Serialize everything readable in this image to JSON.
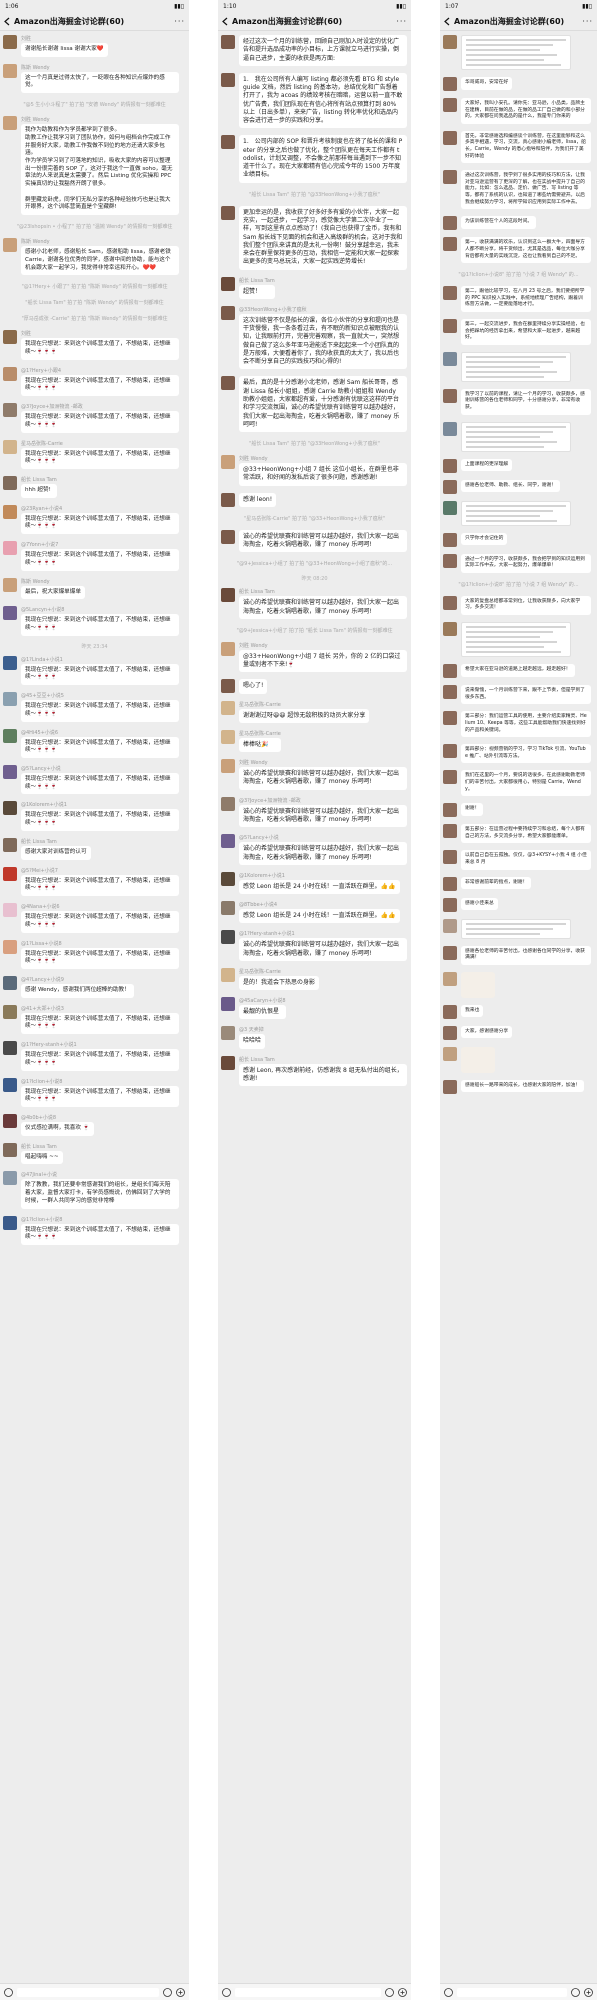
{
  "panel1": {
    "status_time": "1:06",
    "title": "Amazon出海掘金讨论群(60)",
    "messages": [
      {
        "kind": "msg",
        "sender": "刘胜",
        "text": "谢谢船长谢谢 lissa 谢谢大家❤️",
        "color": "#8a6a4a"
      },
      {
        "kind": "msg",
        "sender": "陈斯 Wendy",
        "text": "这一个月真是过得太快了，一眨眼在各种知识点爆炸的感觉。",
        "color": "#c9a07a"
      },
      {
        "kind": "sys",
        "text": "\"@5 生小小斗程了\" 拍了拍 \"安德 Wendy\" 的情报有一刻都难住"
      },
      {
        "kind": "msg",
        "sender": "刘胜 Wendy",
        "text": "我作为助教和作为学员都学到了很多。\n助教工作让我学习到了团队协作，如何与组档合作完成工作并服务好大家，助教工作我做不到位的地方还请大家多包涵。\n作为学员学习到了可落地的知识，吸收大家的内容可以整理出一份很完善的 SOP 了，这对于我这个一直做 soho，毫无章法的人来说真是太需要了。然后 Listing 优化实操和 PPC 实操真切的让我豁然开朗了很多。\n\n群里藏龙卧虎，同学们无私分享的各种经验技巧也是让我大开眼界，这个训练营简直是个宝藏群!",
        "color": "#c9a07a"
      },
      {
        "kind": "sys",
        "text": "\"@23Ishopsin • 小程了\" 拍了拍 \"温婉 Wendy\" 的情报有一刻都难住"
      },
      {
        "kind": "msg",
        "sender": "陈斯 Wendy",
        "text": "感谢小北老师，感谢船长 Sam，感谢船助 lissa，感谢老铁 Carrie，谢谢各位优秀的同学，感谢中间的协助，能与这个机会跟大家一起学习，我觉得非常幸运和开心。❤️❤️",
        "color": "#c9a07a"
      },
      {
        "kind": "sys",
        "text": "\"@1?Hery+ 小跟了\" 拍了拍 \"陈斯 Wendy\" 的情报有一刻都难住"
      },
      {
        "kind": "sys",
        "text": "\"船长 Lissa Tam\" 拍了拍 \"陈斯 Wendy\" 的情报有一刻都难住"
      },
      {
        "kind": "sys",
        "text": "\"厚马岳成张 -Carrie\" 拍了拍 \"陈斯 Wendy\" 的情报有一刻都难住"
      },
      {
        "kind": "msg",
        "sender": "刘胜",
        "text": "我现在只想说：来到这个训练营太值了，不想结束，还想继续～🍷🍷🍷",
        "color": "#8a6a4a"
      },
      {
        "kind": "msg",
        "sender": "@1?Hery+小跟4",
        "text": "我现在只想说：来到这个训练营太值了，不想结束，还想继续～🍷🍷🍷",
        "color": "#b98d6a"
      },
      {
        "kind": "msg",
        "sender": "@3?Joyce+加洲物流 -邮政",
        "text": "我现在只想说：来到这个训练营太值了，不想结束，还想继续～🍷🍷🍷",
        "color": "#8f7b6a"
      },
      {
        "kind": "msg",
        "sender": "星马岳张陈-Carrie",
        "text": "我现在只想说：来到这个训练营太值了，不想结束，还想继续～🍷🍷🍷",
        "color": "#d2b48c"
      },
      {
        "kind": "msg",
        "sender": "船长 Lissa Tam",
        "text": "hhh 超赞!",
        "color": "#7f6a5a"
      },
      {
        "kind": "msg",
        "sender": "@23Ryan+小说4",
        "text": "我现在只想说：来到这个训练营太值了，不想结束，还想继续～🍷🍷🍷",
        "color": "#c18a5a"
      },
      {
        "kind": "msg",
        "sender": "@7Yonn+小说7",
        "text": "我现在只想说：来到这个训练营太值了，不想结束，还想继续～🍷🍷🍷",
        "color": "#e8a0b0"
      },
      {
        "kind": "msg",
        "sender": "陈斯 Wendy",
        "text": "最后，祝大家爆单爆单",
        "color": "#c9a07a"
      },
      {
        "kind": "msg",
        "sender": "@5Lancyn+小说8",
        "text": "我现在只想说：来到这个训练营太值了，不想结束，还想继续～🍷🍷🍷",
        "color": "#6f5f8f"
      },
      {
        "kind": "time",
        "text": "昨天 23:34"
      },
      {
        "kind": "msg",
        "sender": "@1?Linda+小说1",
        "text": "我现在只想说：来到这个训练营太值了，不想结束，还想继续～🍷🍷🍷",
        "color": "#3c5f8f"
      },
      {
        "kind": "msg",
        "sender": "@45+豆豆+小说5",
        "text": "我现在只想说：来到这个训练营太值了，不想结束，还想继续～🍷🍷🍷",
        "color": "#8aa0b0"
      },
      {
        "kind": "msg",
        "sender": "@4Hi45+小说6",
        "text": "我现在只想说：来到这个训练营太值了，不想结束，还想继续～🍷🍷🍷",
        "color": "#5f7f5f"
      },
      {
        "kind": "msg",
        "sender": "@5?Lancy+小说",
        "text": "我现在只想说：来到这个训练营太值了，不想结束，还想继续～🍷🍷🍷",
        "color": "#6f5f8f"
      },
      {
        "kind": "msg",
        "sender": "@1Kolorem+小说1",
        "text": "我现在只想说：来到这个训练营太值了，不想结束，还想继续～🍷🍷🍷",
        "color": "#5a4a3a"
      },
      {
        "kind": "msg",
        "sender": "船长 Lissa Tam",
        "text": "感谢大家对训练营的认可",
        "color": "#7f6a5a"
      },
      {
        "kind": "msg",
        "sender": "@5?Mei+小说7",
        "text": "我现在只想说：来到这个训练营太值了，不想结束，还想继续～🍷🍷🍷",
        "color": "#c0392b"
      },
      {
        "kind": "msg",
        "sender": "@4Nana+小说6",
        "text": "我现在只想说：来到这个训练营太值了，不想结束，还想继续～🍷🍷🍷",
        "color": "#e8c0d0"
      },
      {
        "kind": "msg",
        "sender": "@1?Lissa+小说8",
        "text": "我现在只想说：来到这个训练营太值了，不想结束，还想继续～🍷🍷🍷",
        "color": "#d9a080"
      },
      {
        "kind": "msg",
        "sender": "@4?Lancy+小说9",
        "text": "感谢 Wendy，感谢我们两位超棒的助教！",
        "color": "#5a6a7a"
      },
      {
        "kind": "msg",
        "sender": "@41+大郑+小说3",
        "text": "我现在只想说：来到这个训练营太值了，不想结束，还想继续～🍷🍷🍷",
        "color": "#8a7a5a"
      },
      {
        "kind": "msg",
        "sender": "@1?Hery-stanh+小说1",
        "text": "我现在只想说：来到这个训练营太值了，不想结束，还想继续～🍷🍷🍷",
        "color": "#4a4a4a"
      },
      {
        "kind": "msg",
        "sender": "@1?Iclion+小说8",
        "text": "我现在只想说：来到这个训练营太值了，不想结束，还想继续～🍷🍷🍷",
        "color": "#3a5a8a"
      },
      {
        "kind": "msg",
        "sender": "@4b0b+小说8",
        "text": "仪式感拉满啊，我喜欢 🍷",
        "color": "#6a3a3a"
      },
      {
        "kind": "msg",
        "sender": "船长 Lissa Tam",
        "text": "唱起嗨嗨 ~~",
        "color": "#7f6a5a"
      },
      {
        "kind": "msg",
        "sender": "@47Jinal+小说",
        "text": "除了教教，我们还要非常感谢我们的组长，是组长们每天陪着大家，监督大家打卡，有学员感慨说，仿佛回到了大学的时候，一群人共同学习的感觉非常棒",
        "color": "#8a9aaa"
      },
      {
        "kind": "msg",
        "sender": "@1?Iclion+小说8",
        "text": "我现在只想说：来到这个训练营太值了，不想结束，还想继续～🍷🍷🍷",
        "color": "#3a5a8a"
      }
    ]
  },
  "panel2": {
    "status_time": "1:10",
    "title": "Amazon出海掘金讨论群(60)",
    "messages": [
      {
        "kind": "msg",
        "sender": "",
        "text": "经过这次一个月的训练营，回顾自己刚加入时设定的优化广告和提升选品成功率的小目标，上方课就立马进行实操，倒逼自己进步，主要的收获是两方面:",
        "color": "#7a5a4a"
      },
      {
        "kind": "msg",
        "sender": "",
        "text": "1.　我在公司所有人编写 listing 都必须先看 BTG 和 style guide 文档，然后 listing 的基本功，总结优化和广告想着打开了，我为 acoas 的绩效考核在暗暗，运营以前一直不敢优广告费，我们团队现在有信心将所有站点预算打到 80% 以上（日出多单），来来广告，listing 转化率优化和选品内容会进行进一步的实践和分享。",
        "color": "#7a5a4a"
      },
      {
        "kind": "msg",
        "sender": "",
        "text": "1.　公司内部的 SOP 和晋升考核制度也在将了船长的课和 Peter 的分享之后也做了优化，整个团队更在每天工作都有 todolist，计划又调整，不会像之前那样每当遇到下一步不知道干什么了。现在大家都精有信心完成今年的 1500 万年度业绩目标。",
        "color": "#7a5a4a"
      },
      {
        "kind": "sys",
        "text": "\"船长 Lissa Tam\" 拍了拍 \"@33HeonWong+小我了瘟秋\""
      },
      {
        "kind": "msg",
        "sender": "",
        "text": "更加幸运的是，我收获了好多好多有爱的小伙伴，大家一起充实，一起进步，一起学习，感觉像大学第二次毕业了一样，写到这里有点点感动了！(我自己也获得了金币，我有和 Sam 船长线下见面的机会和进入高级群的机会，这对于我和我们整个团队来讲真的是太礼一份啊！鼓分享越幸运，我未来会在群里保持更多的互动，我相信一定能和大家一起探索出更多的变马总玩法，大家一起实践逆势增长!",
        "color": "#7a5a4a"
      },
      {
        "kind": "msg",
        "sender": "船长 Lissa Tam",
        "text": "超赞！",
        "color": "#6a4a3a"
      },
      {
        "kind": "msg",
        "sender": "@33HeonWong+小我了瘟秋",
        "text": "这次训练营不仅是船长的课，各位小伙伴的分享和提问也是干货慢慢，我一条条看过去，有不眠的新知识点被眠我的认知，让我眼前打开，完善完善观察，我一直就大一，突然想做自己做了这么多年亚马逊能适下来起起来一个小团队真的是万般难，大便看着你了，我的收获真的太大了，我以后也会不断分享自己的实践技巧和心得的!",
        "color": "#7a5a4a"
      },
      {
        "kind": "msg",
        "sender": "",
        "text": "最后，真的是十分感谢小北老师，感谢 Sam 船长哥哥，感谢 Lissa 船长小姐姐，感谢 Carrie 助教小姐姐和 Wendy 助教小姐姐，大家都超有爱，十分感谢有优联这这样的平台和学习交流氛围，诚心的希望优联有训练营可以越办越好，我们大家一起出海掏金，吃着火锅唱着歌，赚了 money 乐呵呵!",
        "color": "#7a5a4a"
      },
      {
        "kind": "sys",
        "text": "\"船长 Lissa Tam\" 拍了拍 \"@33HeonWong+小我了瘟秋\""
      },
      {
        "kind": "msg",
        "sender": "刘胜 Wendy",
        "text": "@33+HeonWong+小组 7 组长 这位小组长，在群里也非常活跃，和好闻的发私后谈了很多问题，感谢感谢!",
        "color": "#c9a07a"
      },
      {
        "kind": "msg",
        "sender": "",
        "text": "感谢 leon!",
        "color": "#7a5a4a"
      },
      {
        "kind": "sys",
        "text": "\"星马岳张陈-Carrie\" 拍了拍 \"@33+HeonWong+小我了瘟秋\""
      },
      {
        "kind": "msg",
        "sender": "",
        "text": "诚心的希望优联赛和训练营可以越办越好，我们大家一起出海掏金，吃着火锅唱着歌，赚了 money 乐呵呵!",
        "color": "#7a5a4a"
      },
      {
        "kind": "sys",
        "text": "\"@9+Jessica+小组了 拍了拍 \"@33+HeonWong+小组了瘟秋\"的..."
      },
      {
        "kind": "time",
        "text": "昨天 08:20"
      },
      {
        "kind": "msg",
        "sender": "船长 Lissa Tam",
        "text": "诚心的希望优联赛和训练营可以越办越好，我们大家一起出海掏金，吃着火锅唱着歌，赚了 money 乐呵呵!",
        "color": "#6a4a3a"
      },
      {
        "kind": "sys",
        "text": "\"@9+Jessica+小组了 拍了拍 \"船长 Lissa Tam\" 的情报有一刻都难住"
      },
      {
        "kind": "msg",
        "sender": "刘胜 Wendy",
        "text": "@33+HeonWong+小组 7 组长 另外，你的 2 亿的口袋过量或别者不下来!🍷",
        "color": "#c9a07a"
      },
      {
        "kind": "msg",
        "sender": "",
        "text": "嗯心了!",
        "color": "#7a5a4a"
      },
      {
        "kind": "msg",
        "sender": "星马岳张陈-Carrie",
        "text": "谢谢谢过呀😆😆 超惊无敌积极的动员大家分享",
        "color": "#d2b48c"
      },
      {
        "kind": "msg",
        "sender": "星马岳张陈-Carrie",
        "text": "棒棒哒🎉",
        "color": "#d2b48c"
      },
      {
        "kind": "msg",
        "sender": "刘胜 Wendy",
        "text": "诚心的希望优联赛和训练营可以越办越好，我们大家一起出海掏金，吃着火锅唱着歌，赚了 money 乐呵呵!",
        "color": "#c9a07a"
      },
      {
        "kind": "msg",
        "sender": "@3?Joyce+加洲物流 -邮政",
        "text": "诚心的希望优联赛和训练营可以越办越好，我们大家一起出海掏金，吃着火锅唱着歌，赚了 money 乐呵呵!",
        "color": "#8f7b6a"
      },
      {
        "kind": "msg",
        "sender": "@5?Lancy+小说",
        "text": "诚心的希望优联赛和训练营可以越办越好，我们大家一起出海掏金，吃着火锅唱着歌，赚了 money 乐呵呵!",
        "color": "#6f5f8f"
      },
      {
        "kind": "msg",
        "sender": "@1Kolorem+小说1",
        "text": "感觉 Leon 组长是 24 小时在线！一直活跃在群里。👍👍",
        "color": "#5a4a3a"
      },
      {
        "kind": "msg",
        "sender": "@8Tbbe+小说4",
        "text": "感觉 Leon 组长是 24 小时在线！一直活跃在群里。👍👍",
        "color": "#8a7a6a"
      },
      {
        "kind": "msg",
        "sender": "@1?Hery-stanh+小说1",
        "text": "诚心的希望优联赛和训练营可以越办越好，我们大家一起出海掏金，吃着火锅唱着歌，赚了 money 乐呵呵!",
        "color": "#4a4a4a"
      },
      {
        "kind": "msg",
        "sender": "星马岳张陈-Carrie",
        "text": "是的！我道会下热思の身影",
        "color": "#d2b48c"
      },
      {
        "kind": "msg",
        "sender": "@45aCaryn+小说8",
        "text": "最靓的仇恨星",
        "color": "#6a5a8a"
      },
      {
        "kind": "msg",
        "sender": "@3 天卖掉",
        "text": "哈哈哈",
        "color": "#9a8a7a"
      },
      {
        "kind": "msg",
        "sender": "船长 Lissa Tam",
        "text": "感谢 Leon, 再次感谢前经，仿感谢我 8 组无私付出的组长，感谢!",
        "color": "#6a4a3a"
      }
    ]
  },
  "panel3": {
    "status_time": "1:07",
    "title": "Amazon出海掘金讨论群(60)",
    "messages": [
      {
        "kind": "img",
        "sender": "",
        "lines": 6,
        "color": "#9a7a5a"
      },
      {
        "kind": "msg",
        "sender": "",
        "text": "华哥威哥，安常在好",
        "color": "#8a6a5a"
      },
      {
        "kind": "msg",
        "sender": "",
        "text": "大家好，我叫小安孔。请你先：亚马逊，小品类，品牌主在建精，目前在做的品，在做的品工厂自己做的和小部分的，大家都在问我选品的是什么，我是专门你来的",
        "color": "#8a6a5a"
      },
      {
        "kind": "msg",
        "sender": "",
        "text": "首先，非常感谢选和编感谈个训练营，在这里能够和这么多高手相遇，学习，交流，真心感谢小编老师，lissa，船长，Carrie，Wendy 的悉心指导和陪伴，为我们开了美好的体验",
        "color": "#8a6a5a"
      },
      {
        "kind": "msg",
        "sender": "",
        "text": "通过这次训练营，我学到了很多实用的技巧和方法，让我对亚马逊运营有了更深的了解，也在实战中提升了自己的能力。比如：怎么选品、定价、做广告、写 listing 等等，都有了系统的认识，也知道了哪些坑需要避开。以后我会继续努力学习，将所学知识应用到实际工作中去。",
        "color": "#8a6a5a"
      },
      {
        "kind": "msg",
        "sender": "",
        "text": "为该训练营在个人的这段时间。",
        "color": "#8a6a5a"
      },
      {
        "kind": "msg",
        "sender": "",
        "text": "第一，收获满满的欢乐，认识到这么一群大牛，四面导方人都不断分享，将干货倾出，尤其是选品，每位大咖分享背后都有大量的实践沉淀，这也让我看到自己的不足。",
        "color": "#8a6a5a"
      },
      {
        "kind": "sys",
        "text": "\"@1?Iclion+小说8\" 拍了拍 \"小说 7 组 Wendy\" 的..."
      },
      {
        "kind": "msg",
        "sender": "",
        "text": "第二，跟他比较学习，在八月 23 号之后，我们要把所学的 PPC 知识投入实践中，系统地梳理广告结构，跟着训练营方法做，一定要能落地才行。",
        "color": "#8a6a5a"
      },
      {
        "kind": "msg",
        "sender": "",
        "text": "第三，一起交流进步，我会在群里持续分享实操经验，也会把踩坑的经历拿出来，希望和大家一起进步，越来越好。",
        "color": "#8a6a5a"
      },
      {
        "kind": "img",
        "sender": "",
        "lines": 5,
        "color": "#7a8a9a"
      },
      {
        "kind": "msg",
        "sender": "",
        "text": "我学习了以前的课程，请让一个月的学习，收获颇多，感谢训练营的各位老师和同学，十分感谢分享，非常有收获。",
        "color": "#8a6a5a"
      },
      {
        "kind": "img",
        "sender": "",
        "lines": 5,
        "color": "#7a8a9a"
      },
      {
        "kind": "msg",
        "sender": "",
        "text": "上面课程的更深理解",
        "color": "#8a6a5a"
      },
      {
        "kind": "msg",
        "sender": "",
        "text": "感谢各位老师、助教、组长、同学，谢谢！",
        "color": "#8a6a5a"
      },
      {
        "kind": "img",
        "sender": "",
        "lines": 4,
        "color": "#5a7a6a"
      },
      {
        "kind": "msg",
        "sender": "",
        "text": "只学你才会记住的",
        "color": "#8a6a5a"
      },
      {
        "kind": "msg",
        "sender": "",
        "text": "通过一个月的学习，收获颇多，我会把学到的知识运用到实际工作中去，大家一起努力，爆单爆单！",
        "color": "#8a6a5a"
      },
      {
        "kind": "sys",
        "text": "\"@1?Iclion+小说8\" 拍了拍 \"小说 7 组 Wendy\" 的..."
      },
      {
        "kind": "msg",
        "sender": "",
        "text": "大家的复盘总结都非常到位，让我收获颇多，向大家学习，多多交流！",
        "color": "#8a6a5a"
      },
      {
        "kind": "img",
        "sender": "",
        "lines": 6,
        "color": "#9a7a5a"
      },
      {
        "kind": "msg",
        "sender": "",
        "text": "希望大家在亚马逊的道路上越走越远，越走越好！",
        "color": "#8a6a5a"
      },
      {
        "kind": "msg",
        "sender": "",
        "text": "说来惭愧，一个月训练营下来，跟不上节奏，但是学到了很多东西。",
        "color": "#8a6a5a"
      },
      {
        "kind": "msg",
        "sender": "",
        "text": "第三部分：我们运营工具的使用，主要介绍卖家精灵、Helium 10、Keepa 等等，这些工具能帮助我们快速找到好的产品和关键词。",
        "color": "#8a6a5a"
      },
      {
        "kind": "msg",
        "sender": "",
        "text": "第四部分：视频营销的学习，学习 TikTok 引流、YouTube 推广、站外引流等方法。",
        "color": "#8a6a5a"
      },
      {
        "kind": "msg",
        "sender": "",
        "text": "我们在这里的一个月，要说的话很多，在此感谢助教老师们的辛苦付出，大家都很用心，特别是 Carrie，Wendy。",
        "color": "#8a6a5a"
      },
      {
        "kind": "msg",
        "sender": "",
        "text": "谢谢！",
        "color": "#8a6a5a"
      },
      {
        "kind": "msg",
        "sender": "",
        "text": "第五部分：在运营过程中要持续学习和总结，每个人都有自己的方法，多交流多分享，希望大家都能爆单。",
        "color": "#8a6a5a"
      },
      {
        "kind": "msg",
        "sender": "",
        "text": "以前自己自在五孤独。仅仅，@3+KYSY+小我 4 组 小佳来总 8 月",
        "color": "#8a6a5a"
      },
      {
        "kind": "msg",
        "sender": "",
        "text": "非常感谢前辈的指点，谢谢！",
        "color": "#8a6a5a"
      },
      {
        "kind": "msg",
        "sender": "",
        "text": "感谢小佳来总",
        "color": "#8a6a5a"
      },
      {
        "kind": "img",
        "sender": "",
        "lines": 3,
        "color": "#b09a8a"
      },
      {
        "kind": "msg",
        "sender": "",
        "text": "感谢各位老师的辛苦付出，也感谢各位同学的分享，收获满满！",
        "color": "#8a6a5a"
      },
      {
        "kind": "sticker",
        "sender": "",
        "color": "#c0a080"
      },
      {
        "kind": "msg",
        "sender": "",
        "text": "我来也",
        "color": "#8a6a5a"
      },
      {
        "kind": "msg",
        "sender": "",
        "text": "大家，感谢感谢分享",
        "color": "#8a6a5a"
      },
      {
        "kind": "sticker",
        "sender": "",
        "color": "#c0a080"
      },
      {
        "kind": "msg",
        "sender": "",
        "text": "感谢船长一路带来的成长，也感谢大家的陪伴，加油！",
        "color": "#8a6a5a"
      }
    ]
  }
}
